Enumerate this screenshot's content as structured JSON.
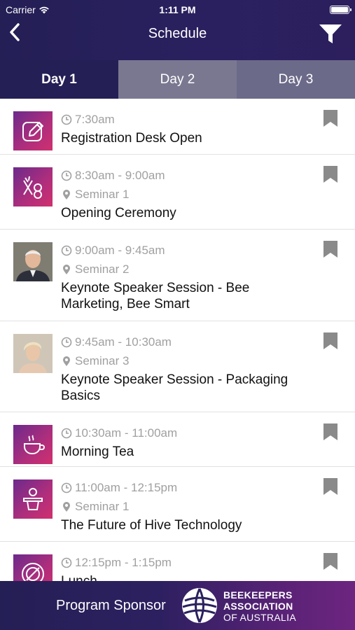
{
  "status_bar": {
    "carrier": "Carrier",
    "time": "1:11 PM"
  },
  "nav": {
    "title": "Schedule",
    "back_icon": "chevron-left-icon",
    "filter_icon": "filter-icon"
  },
  "tabs": [
    {
      "label": "Day 1",
      "active": true
    },
    {
      "label": "Day 2",
      "active": false
    },
    {
      "label": "Day 3",
      "active": false
    }
  ],
  "sessions": [
    {
      "time": "7:30am",
      "location": "",
      "title": "Registration Desk Open",
      "thumb": "edit-icon"
    },
    {
      "time": "8:30am - 9:00am",
      "location": "Seminar 1",
      "title": "Opening Ceremony",
      "thumb": "ceremony-icon"
    },
    {
      "time": "9:00am - 9:45am",
      "location": "Seminar 2",
      "title": "Keynote Speaker Session - Bee Marketing, Bee Smart",
      "thumb": "speaker-photo"
    },
    {
      "time": "9:45am - 10:30am",
      "location": "Seminar 3",
      "title": "Keynote Speaker Session - Packaging Basics",
      "thumb": "speaker-photo"
    },
    {
      "time": "10:30am - 11:00am",
      "location": "",
      "title": "Morning Tea",
      "thumb": "coffee-cup-icon"
    },
    {
      "time": "11:00am - 12:15pm",
      "location": "Seminar 1",
      "title": "The Future of Hive Technology",
      "thumb": "podium-icon"
    },
    {
      "time": "12:15pm - 1:15pm",
      "location": "",
      "title": "Lunch",
      "thumb": "dining-icon"
    }
  ],
  "footer": {
    "label": "Program Sponsor",
    "logo_line1": "BEEKEEPERS",
    "logo_line2": "ASSOCIATION",
    "logo_line3": "OF AUSTRALIA"
  },
  "colors": {
    "header": "#241f55",
    "tab_inactive": "#7a7891",
    "accent_gradient_start": "#6c2a8c",
    "accent_gradient_end": "#d0306e",
    "meta_text": "#a0a0a0",
    "bookmark": "#8a8a8a"
  }
}
